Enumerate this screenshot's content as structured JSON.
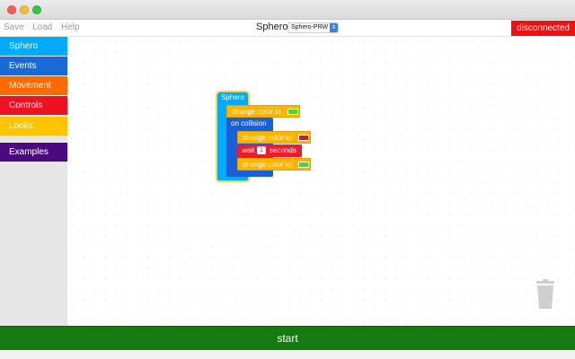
{
  "menu": {
    "save": "Save",
    "load": "Load",
    "help": "Help"
  },
  "device": {
    "label": "Sphero:",
    "selected": "Sphero-PRW"
  },
  "status": {
    "label": "disconnected",
    "color": "#ee1111"
  },
  "sidebar": {
    "categories": [
      {
        "label": "Sphero",
        "color": "#00aaff"
      },
      {
        "label": "Events",
        "color": "#1a6ad6"
      },
      {
        "label": "Movement",
        "color": "#ff6a00"
      },
      {
        "label": "Controls",
        "color": "#ee1122"
      },
      {
        "label": "Looks",
        "color": "#ffc400"
      },
      {
        "label": "Examples",
        "color": "#4b0a82"
      }
    ]
  },
  "blocks": {
    "hat": "Sphero",
    "color1_label": "change color to",
    "color1_value": "#44dd22",
    "event_label": "on collision",
    "color2_label": "change color to",
    "color2_value": "#ee1111",
    "wait_label": "wait",
    "wait_value": "1",
    "wait_unit": "seconds",
    "color3_label": "change color to",
    "color3_value": "#44dd22"
  },
  "start": {
    "label": "start",
    "color": "#157a10"
  }
}
